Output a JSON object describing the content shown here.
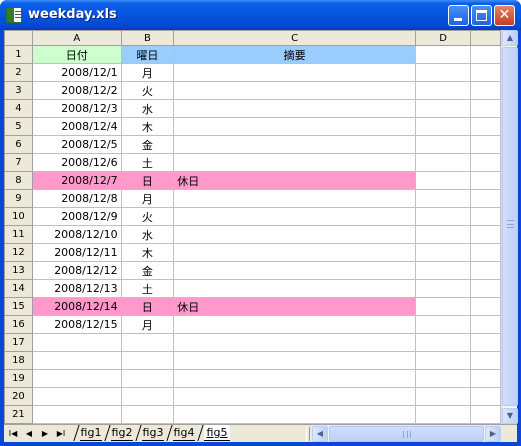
{
  "window": {
    "title": "weekday.xls"
  },
  "columns": [
    "A",
    "B",
    "C",
    "D"
  ],
  "header_row": {
    "date": "日付",
    "weekday": "曜日",
    "summary": "摘要"
  },
  "rows": [
    {
      "num": "1"
    },
    {
      "num": "2",
      "date": "2008/12/1",
      "weekday": "月",
      "summary": "",
      "holiday": false
    },
    {
      "num": "3",
      "date": "2008/12/2",
      "weekday": "火",
      "summary": "",
      "holiday": false
    },
    {
      "num": "4",
      "date": "2008/12/3",
      "weekday": "水",
      "summary": "",
      "holiday": false
    },
    {
      "num": "5",
      "date": "2008/12/4",
      "weekday": "木",
      "summary": "",
      "holiday": false
    },
    {
      "num": "6",
      "date": "2008/12/5",
      "weekday": "金",
      "summary": "",
      "holiday": false
    },
    {
      "num": "7",
      "date": "2008/12/6",
      "weekday": "土",
      "summary": "",
      "holiday": false
    },
    {
      "num": "8",
      "date": "2008/12/7",
      "weekday": "日",
      "summary": "休日",
      "holiday": true
    },
    {
      "num": "9",
      "date": "2008/12/8",
      "weekday": "月",
      "summary": "",
      "holiday": false
    },
    {
      "num": "10",
      "date": "2008/12/9",
      "weekday": "火",
      "summary": "",
      "holiday": false
    },
    {
      "num": "11",
      "date": "2008/12/10",
      "weekday": "水",
      "summary": "",
      "holiday": false
    },
    {
      "num": "12",
      "date": "2008/12/11",
      "weekday": "木",
      "summary": "",
      "holiday": false
    },
    {
      "num": "13",
      "date": "2008/12/12",
      "weekday": "金",
      "summary": "",
      "holiday": false
    },
    {
      "num": "14",
      "date": "2008/12/13",
      "weekday": "土",
      "summary": "",
      "holiday": false
    },
    {
      "num": "15",
      "date": "2008/12/14",
      "weekday": "日",
      "summary": "休日",
      "holiday": true
    },
    {
      "num": "16",
      "date": "2008/12/15",
      "weekday": "月",
      "summary": "",
      "holiday": false
    },
    {
      "num": "17",
      "date": "",
      "weekday": "",
      "summary": "",
      "holiday": false
    },
    {
      "num": "18",
      "date": "",
      "weekday": "",
      "summary": "",
      "holiday": false
    },
    {
      "num": "19",
      "date": "",
      "weekday": "",
      "summary": "",
      "holiday": false
    },
    {
      "num": "20",
      "date": "",
      "weekday": "",
      "summary": "",
      "holiday": false
    },
    {
      "num": "21",
      "date": "",
      "weekday": "",
      "summary": "",
      "holiday": false
    }
  ],
  "sheet_tabs": [
    "fig1",
    "fig2",
    "fig3",
    "fig4",
    "fig5"
  ],
  "active_tab": "fig5",
  "nav_buttons": {
    "first": "I◀",
    "prev": "◀",
    "next": "▶",
    "last": "▶I"
  },
  "icons": {
    "app": "excel-document-icon",
    "minimize": "minimize-icon",
    "maximize": "maximize-icon",
    "close": "close-icon"
  },
  "colors": {
    "header_date": "#ccffcc",
    "header_weekday": "#99ccff",
    "header_summary": "#99ccff",
    "holiday_row": "#ff99cc",
    "titlebar": "#0753e0"
  }
}
